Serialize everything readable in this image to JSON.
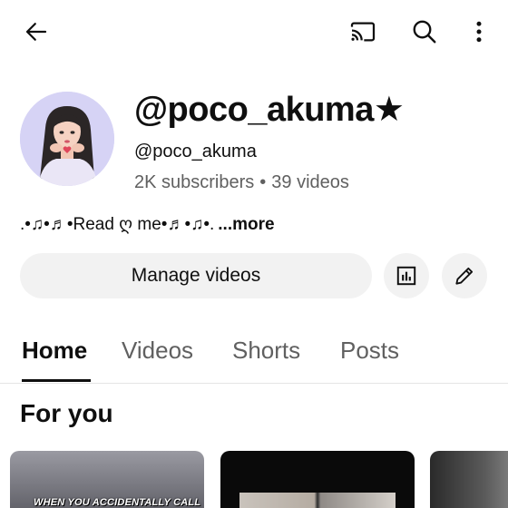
{
  "topbar": {
    "back_icon": "arrow-left-icon",
    "cast_icon": "cast-icon",
    "search_icon": "search-icon",
    "more_icon": "more-vertical-icon"
  },
  "channel": {
    "title": "@poco_akuma★",
    "handle": "@poco_akuma",
    "subscribers": "2K subscribers",
    "separator": "•",
    "videos": "39 videos",
    "description": ".•♫•♬•Read ღ me•♬•♫•.",
    "more_label": "...more"
  },
  "actions": {
    "manage_label": "Manage videos",
    "analytics_icon": "analytics-icon",
    "edit_icon": "pencil-icon"
  },
  "tabs": [
    {
      "label": "Home",
      "active": true
    },
    {
      "label": "Videos",
      "active": false
    },
    {
      "label": "Shorts",
      "active": false
    },
    {
      "label": "Posts",
      "active": false
    }
  ],
  "section": {
    "title": "For you"
  },
  "videos": [
    {
      "caption": "WHEN YOU  ACCIDENTALLY CALL"
    }
  ],
  "colors": {
    "text_primary": "#0f0f0f",
    "text_secondary": "#606060",
    "button_bg": "#f2f2f2",
    "avatar_bg": "#d6d3f5"
  }
}
